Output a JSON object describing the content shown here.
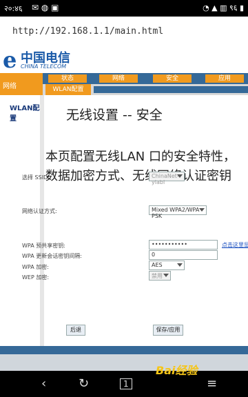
{
  "status_bar": {
    "time": "२०:४६",
    "left_icons": "✉ ◍ ▣",
    "right_icons": "◔ ▲ ▥ ९६ ▮"
  },
  "browser": {
    "url": "http://192.168.1.1/main.html"
  },
  "brand": {
    "mark": "e",
    "name_cn": "中国电信",
    "name_en": "CHINA TELECOM"
  },
  "nav": {
    "side_tab": "网络",
    "tabs": [
      "状态",
      "网络",
      "安全",
      "应用"
    ],
    "sub_active": "WLAN配置"
  },
  "sidebar": {
    "item": "WLAN配置"
  },
  "content": {
    "title": "无线设置 -- 安全",
    "desc_line1": "本页配置无线LAN 口的安全特性，",
    "desc_line2": "数据加密方式、无线网络认证密钥",
    "fields": {
      "ssid_label": "选择 SSID:",
      "ssid_value": "ChinaNet-ylabl",
      "auth_label": "网络认证方式:",
      "auth_value": "Mixed WPA2/WPA -PSK",
      "psk_label": "WPA 预共享密钥:",
      "psk_value": "•••••••••••",
      "psk_link": "点击这里显",
      "rekey_label": "WPA 更新会话密钥间隔:",
      "rekey_value": "0",
      "enc_label": "WPA 加密:",
      "enc_value": "AES",
      "wep_label": "WEP 加密:",
      "wep_value": "禁用"
    },
    "buttons": {
      "back": "后退",
      "save": "保存/应用"
    }
  },
  "android_nav": {
    "back": "‹",
    "refresh": "↻",
    "tabs": "1",
    "menu": "≡"
  },
  "watermark": "Bai经验"
}
